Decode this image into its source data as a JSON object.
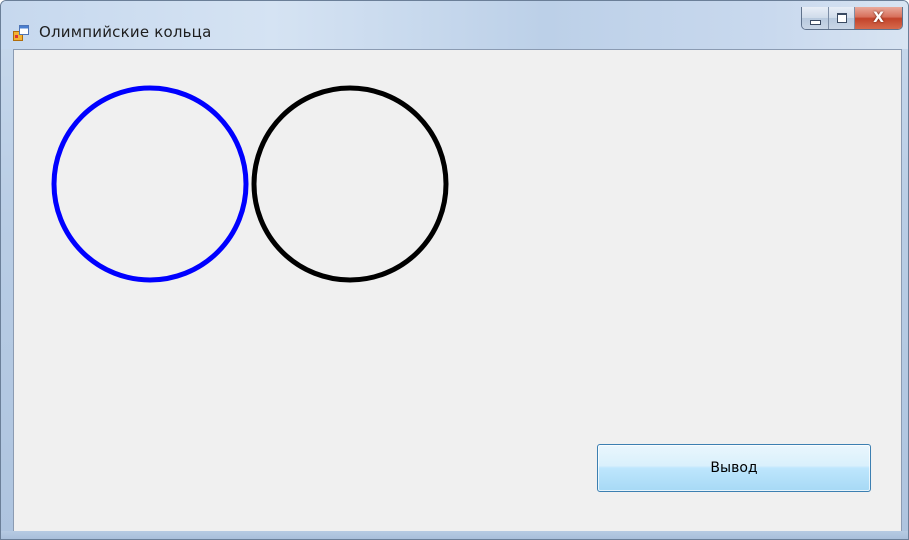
{
  "window": {
    "title": "Олимпийские кольца",
    "app_icon": "form-app-icon",
    "caption_buttons": {
      "minimize": "minimize-icon",
      "maximize": "maximize-icon",
      "close": "close-icon",
      "close_glyph": "X"
    }
  },
  "drawing": {
    "rings": [
      {
        "name": "blue-ring",
        "color": "#0000ff"
      },
      {
        "name": "black-ring",
        "color": "#000000"
      }
    ]
  },
  "form": {
    "output_button_label": "Вывод"
  }
}
